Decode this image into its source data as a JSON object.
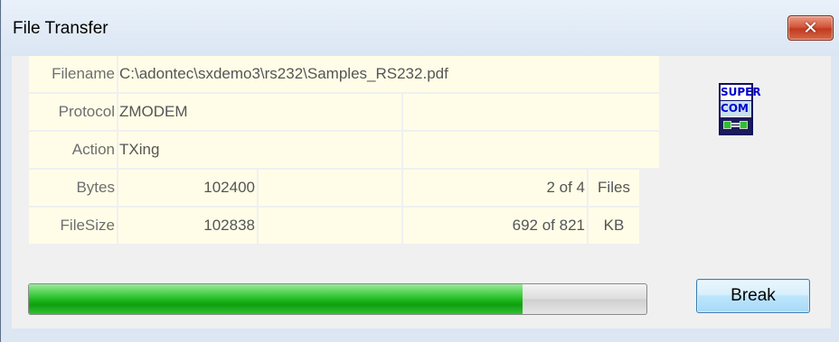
{
  "window": {
    "title": "File Transfer",
    "close_label": "✕"
  },
  "rows": {
    "filename": {
      "label": "Filename",
      "value": "C:\\adontec\\sxdemo3\\rs232\\Samples_RS232.pdf"
    },
    "protocol": {
      "label": "Protocol",
      "value": "ZMODEM"
    },
    "action": {
      "label": "Action",
      "value": "TXing"
    },
    "bytes": {
      "label": "Bytes",
      "value": "102400",
      "count": "2 of 4",
      "unit": "Files"
    },
    "filesize": {
      "label": "FileSize",
      "value": "102838",
      "count": "692 of 821",
      "unit": "KB"
    }
  },
  "logo": {
    "line1": "SUPER",
    "line2": "COM"
  },
  "progress": {
    "fraction": 0.8
  },
  "buttons": {
    "break_label": "Break"
  }
}
